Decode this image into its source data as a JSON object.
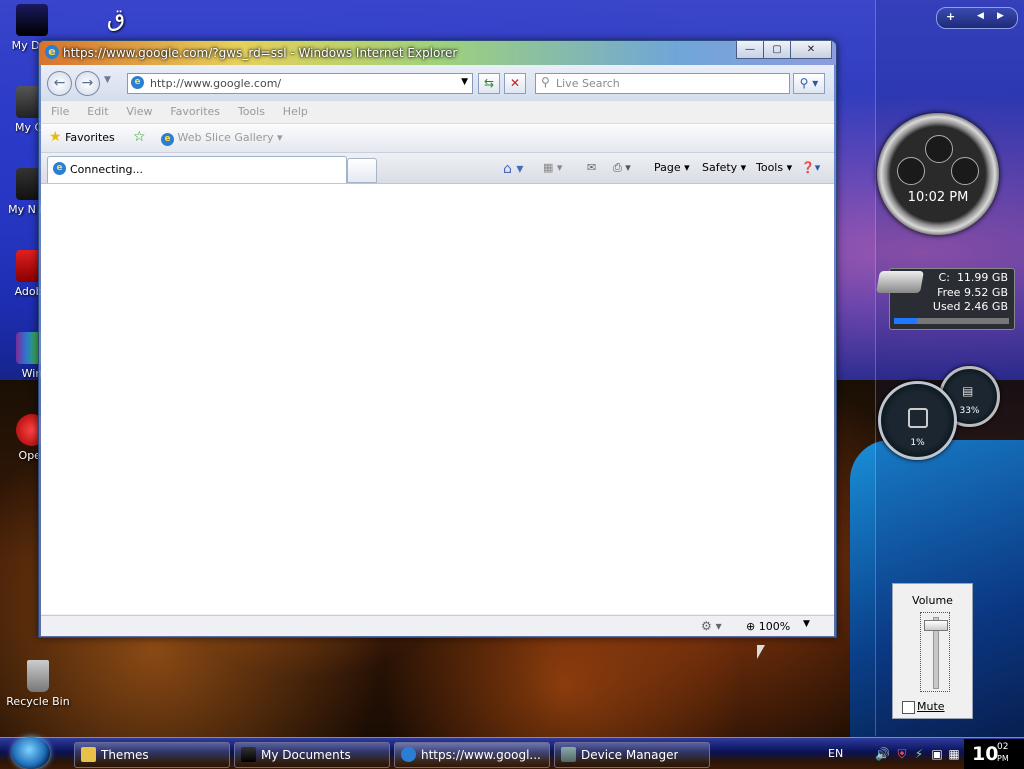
{
  "desktop": {
    "icons": [
      {
        "label": "My Doc"
      },
      {
        "label": "My Co"
      },
      {
        "label": "My N Pla"
      },
      {
        "label": "Adobe"
      },
      {
        "label": "Win"
      },
      {
        "label": "Oper"
      },
      {
        "label": "Recycle Bin"
      }
    ]
  },
  "browser": {
    "title": "https://www.google.com/?gws_rd=ssl - Windows Internet Explorer",
    "title_buttons": {
      "minimize": "—",
      "maximize": "▢",
      "close": "✕"
    },
    "address": "http://www.google.com/",
    "search_placeholder": "Live Search",
    "menu": [
      "File",
      "Edit",
      "View",
      "Favorites",
      "Tools",
      "Help"
    ],
    "favorites_label": "Favorites",
    "web_slice_label": "Web Slice Gallery",
    "tab_label": "Connecting...",
    "commands": {
      "page": "Page",
      "safety": "Safety",
      "tools": "Tools"
    },
    "zoom": "100%"
  },
  "gadgets": {
    "sidebar_controls": {
      "add": "+",
      "prev": "◀",
      "next": "▶"
    },
    "clock_time": "10:02 PM",
    "drive": {
      "drive": "C:",
      "total": "11.99 GB",
      "free_label": "Free",
      "free": "9.52 GB",
      "used_label": "Used",
      "used": "2.46 GB",
      "used_fraction": 0.2
    },
    "cpu_percent": "1%",
    "mem_percent": "33%"
  },
  "volume": {
    "title": "Volume",
    "mute_label": "Mute",
    "muted": false
  },
  "taskbar": {
    "items": [
      {
        "label": "Themes"
      },
      {
        "label": "My Documents"
      },
      {
        "label": "https://www.googl..."
      },
      {
        "label": "Device Manager"
      }
    ],
    "language": "EN",
    "clock_hour": "10",
    "clock_minute": "02",
    "clock_ampm": "PM"
  }
}
